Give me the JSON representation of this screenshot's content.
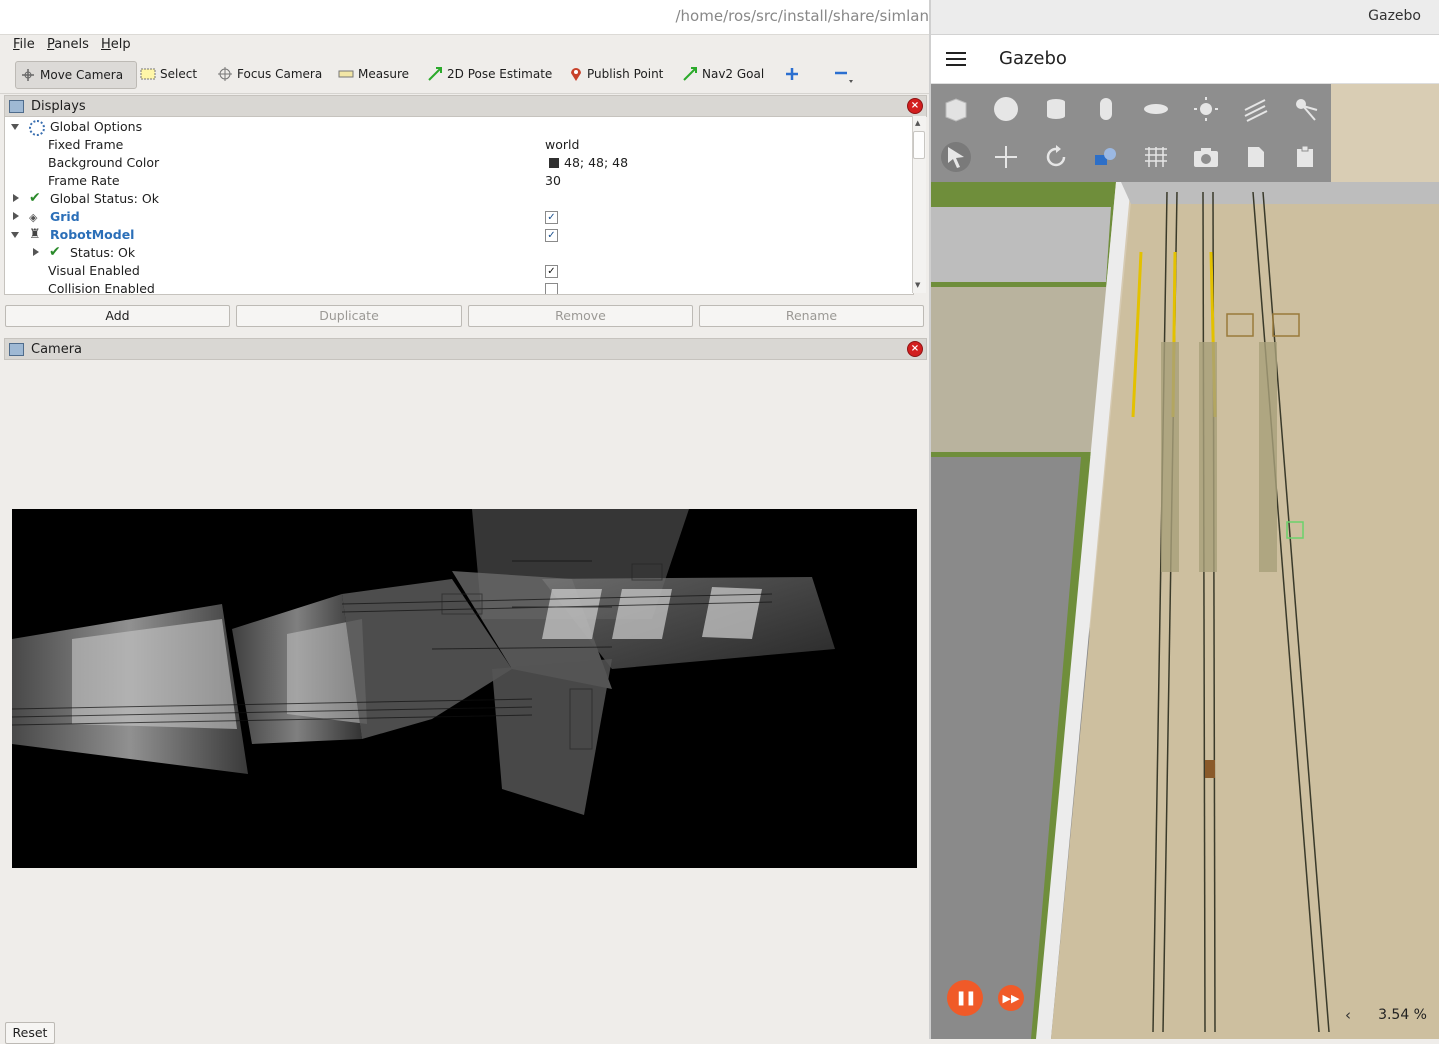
{
  "rviz": {
    "title_path": "/home/ros/src/install/share/simlan",
    "menu": [
      {
        "label": "File",
        "mnemonic": "F",
        "rest": "ile"
      },
      {
        "label": "Panels",
        "mnemonic": "P",
        "rest": "anels"
      },
      {
        "label": "Help",
        "mnemonic": "H",
        "rest": "elp"
      }
    ],
    "toolbar": {
      "move_camera": "Move Camera",
      "select": "Select",
      "focus_camera": "Focus Camera",
      "measure": "Measure",
      "pose_estimate": "2D Pose Estimate",
      "publish_point": "Publish Point",
      "nav2_goal": "Nav2 Goal"
    },
    "displays": {
      "title": "Displays",
      "rows": {
        "global_options": "Global Options",
        "fixed_frame": "Fixed Frame",
        "fixed_frame_value": "world",
        "background_color": "Background Color",
        "background_color_value": "48; 48; 48",
        "background_color_swatch": "#303030",
        "frame_rate": "Frame Rate",
        "frame_rate_value": "30",
        "global_status": "Global Status: Ok",
        "grid": "Grid",
        "robot_model": "RobotModel",
        "status_ok": "Status: Ok",
        "visual_enabled": "Visual Enabled",
        "collision_enabled": "Collision Enabled"
      },
      "buttons": {
        "add": "Add",
        "duplicate": "Duplicate",
        "remove": "Remove",
        "rename": "Rename"
      }
    },
    "camera": {
      "title": "Camera",
      "reset": "Reset"
    }
  },
  "gazebo": {
    "window_title": "Gazebo",
    "app_title": "Gazebo",
    "shape_icons": [
      "box-icon",
      "sphere-icon",
      "cylinder-icon",
      "capsule-icon",
      "ellipsoid-icon",
      "sun-light-icon",
      "directional-light-icon",
      "spot-light-icon"
    ],
    "tool_icons": [
      "select-arrow-icon",
      "translate-icon",
      "rotate-icon",
      "transform-control-icon",
      "grid-config-icon",
      "screenshot-icon",
      "copy-icon",
      "paste-icon"
    ],
    "zoom": "3.54 %",
    "accent_color": "#f05a28"
  }
}
